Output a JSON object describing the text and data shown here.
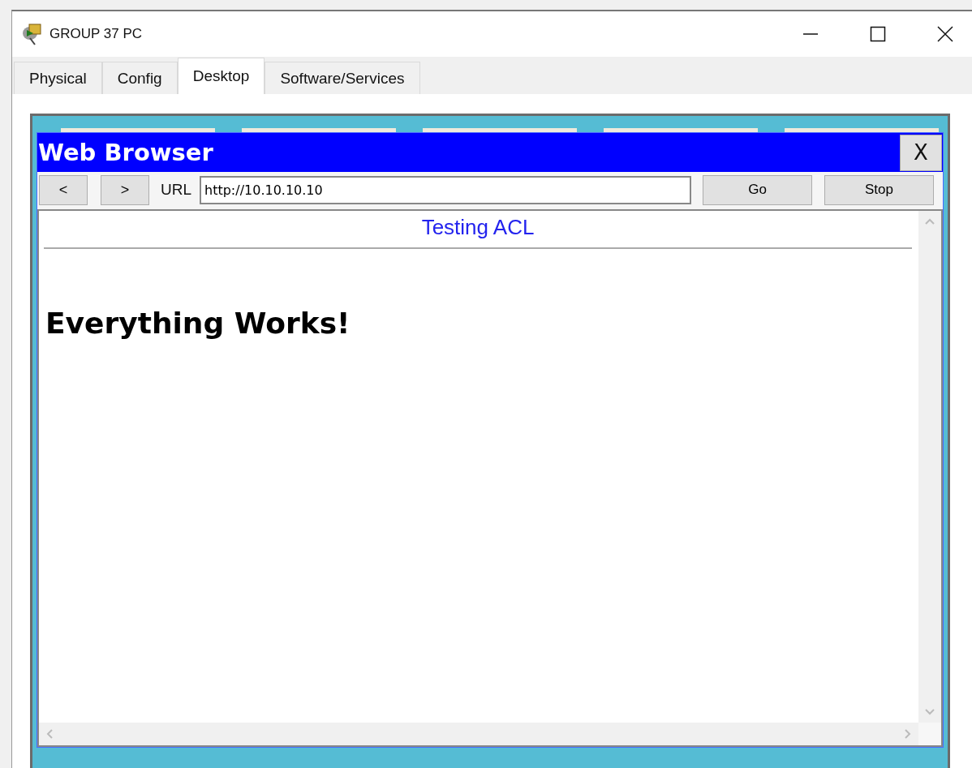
{
  "window": {
    "title": "GROUP 37 PC"
  },
  "tabs": [
    {
      "label": "Physical",
      "selected": false
    },
    {
      "label": "Config",
      "selected": false
    },
    {
      "label": "Desktop",
      "selected": true
    },
    {
      "label": "Software/Services",
      "selected": false
    }
  ],
  "browser": {
    "title": "Web Browser",
    "close_label": "X",
    "back_label": "<",
    "forward_label": ">",
    "url_label": "URL",
    "url": "http://10.10.10.10",
    "go_label": "Go",
    "stop_label": "Stop"
  },
  "page": {
    "title": "Testing ACL",
    "heading": "Everything Works!"
  }
}
